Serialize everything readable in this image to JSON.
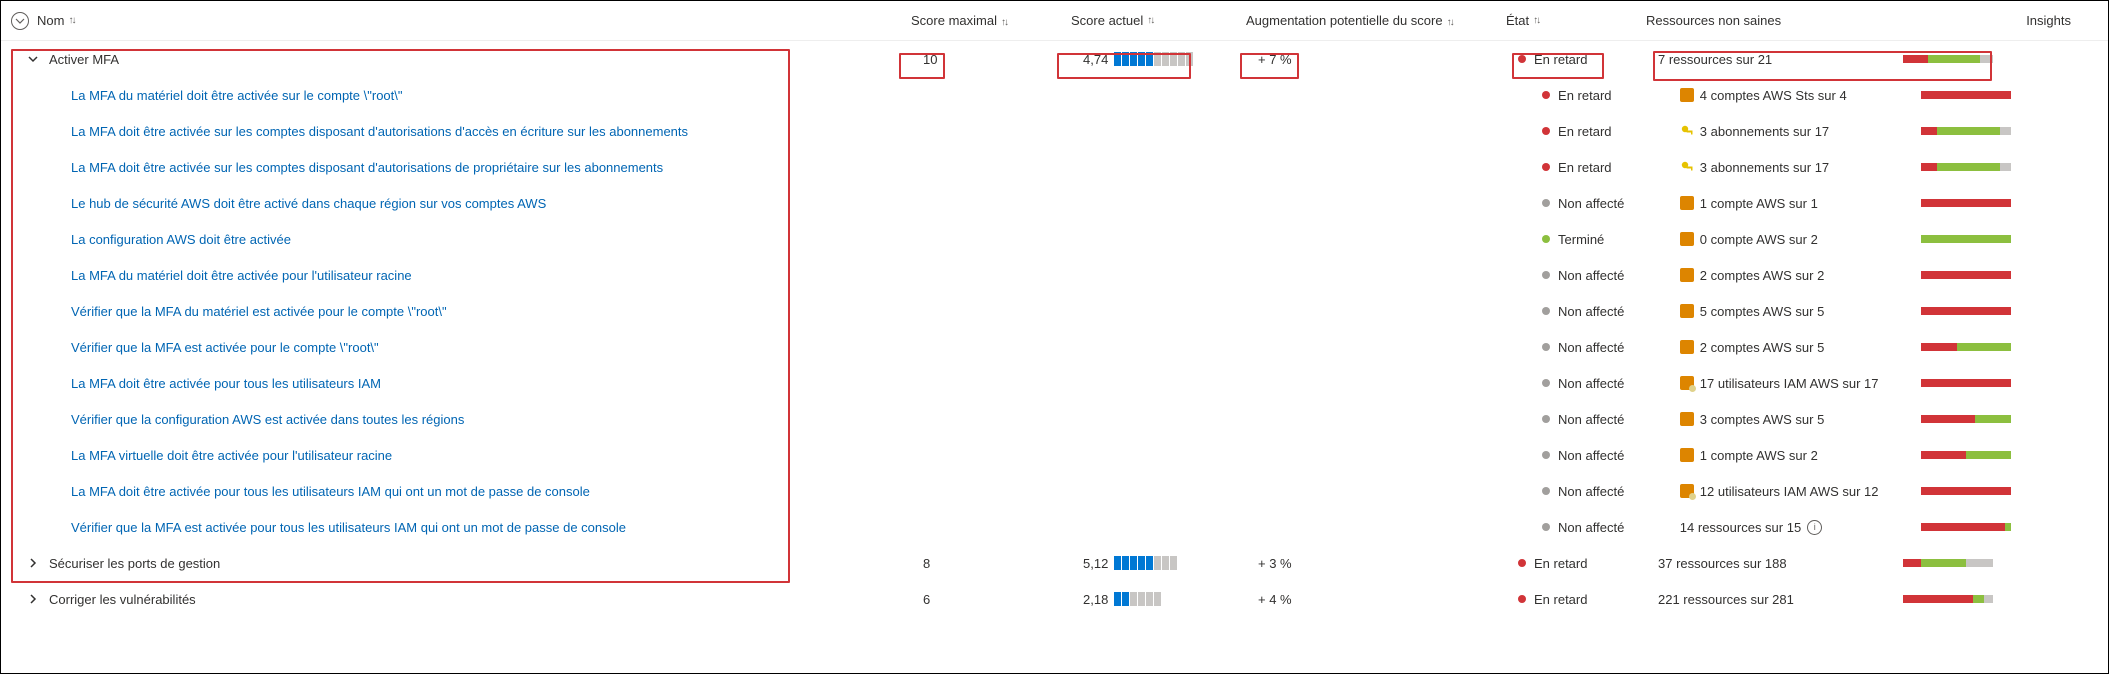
{
  "headers": {
    "name": "Nom",
    "max": "Score maximal",
    "cur": "Score actuel",
    "inc": "Augmentation potentielle du score",
    "state": "État",
    "res": "Ressources non saines",
    "insights": "Insights"
  },
  "groups": [
    {
      "name": "Activer MFA",
      "expanded": true,
      "max": "10",
      "cur": "4,74",
      "cur_blocks_on": 5,
      "cur_blocks_total": 10,
      "inc": "+ 7 %",
      "state_dot": "red",
      "state_text": "En retard",
      "res_text": "7 ressources sur 21",
      "res_icon": "",
      "bar": [
        [
          "r",
          28
        ],
        [
          "g",
          58
        ],
        [
          "gr",
          14
        ]
      ],
      "highlight": true,
      "items": [
        {
          "name": "La MFA du matériel doit être activée sur le compte \\\"root\\\"",
          "state_dot": "red",
          "state_text": "En retard",
          "res_icon": "aws",
          "res_text": "4 comptes AWS Sts sur 4",
          "bar": [
            [
              "r",
              100
            ]
          ]
        },
        {
          "name": "La MFA doit être activée sur les comptes disposant d'autorisations d'accès en écriture sur les abonnements",
          "state_dot": "red",
          "state_text": "En retard",
          "res_icon": "key",
          "res_text": "3 abonnements sur 17",
          "bar": [
            [
              "r",
              18
            ],
            [
              "g",
              70
            ],
            [
              "gr",
              12
            ]
          ]
        },
        {
          "name": "La MFA doit être activée sur les comptes disposant d'autorisations de propriétaire sur les abonnements",
          "state_dot": "red",
          "state_text": "En retard",
          "res_icon": "key",
          "res_text": "3 abonnements sur 17",
          "bar": [
            [
              "r",
              18
            ],
            [
              "g",
              70
            ],
            [
              "gr",
              12
            ]
          ]
        },
        {
          "name": "Le hub de sécurité AWS doit être activé dans chaque région sur vos comptes AWS",
          "state_dot": "grey",
          "state_text": "Non affecté",
          "res_icon": "aws",
          "res_text": "1 compte AWS sur 1",
          "bar": [
            [
              "r",
              100
            ]
          ]
        },
        {
          "name": "La configuration AWS doit être activée",
          "state_dot": "green",
          "state_text": "Terminé",
          "res_icon": "aws",
          "res_text": "0 compte AWS sur 2",
          "bar": [
            [
              "g",
              100
            ]
          ]
        },
        {
          "name": "La MFA du matériel doit être activée pour l'utilisateur racine",
          "state_dot": "grey",
          "state_text": "Non affecté",
          "res_icon": "aws",
          "res_text": "2 comptes AWS sur 2",
          "bar": [
            [
              "r",
              100
            ]
          ]
        },
        {
          "name": "Vérifier que la MFA du matériel est activée pour le compte \\\"root\\\"",
          "state_dot": "grey",
          "state_text": "Non affecté",
          "res_icon": "aws",
          "res_text": "5 comptes AWS sur 5",
          "bar": [
            [
              "r",
              100
            ]
          ]
        },
        {
          "name": "Vérifier que la MFA est activée pour le compte \\\"root\\\"",
          "state_dot": "grey",
          "state_text": "Non affecté",
          "res_icon": "aws",
          "res_text": "2 comptes AWS sur 5",
          "bar": [
            [
              "r",
              40
            ],
            [
              "g",
              60
            ]
          ]
        },
        {
          "name": "La MFA doit être activée pour tous les utilisateurs IAM",
          "state_dot": "grey",
          "state_text": "Non affecté",
          "res_icon": "users",
          "res_text": "17 utilisateurs IAM AWS sur 17",
          "bar": [
            [
              "r",
              100
            ]
          ]
        },
        {
          "name": "Vérifier que la configuration AWS est activée dans toutes les régions",
          "state_dot": "grey",
          "state_text": "Non affecté",
          "res_icon": "aws",
          "res_text": "3 comptes AWS sur 5",
          "bar": [
            [
              "r",
              60
            ],
            [
              "g",
              40
            ]
          ]
        },
        {
          "name": "La MFA virtuelle doit être activée pour l'utilisateur racine",
          "state_dot": "grey",
          "state_text": "Non affecté",
          "res_icon": "aws",
          "res_text": "1 compte AWS sur 2",
          "bar": [
            [
              "r",
              50
            ],
            [
              "g",
              50
            ]
          ]
        },
        {
          "name": "La MFA doit être activée pour tous les utilisateurs IAM qui ont un mot de passe de console",
          "state_dot": "grey",
          "state_text": "Non affecté",
          "res_icon": "users",
          "res_text": "12 utilisateurs IAM AWS sur 12",
          "bar": [
            [
              "r",
              100
            ]
          ]
        },
        {
          "name": "Vérifier que la MFA est activée pour tous les utilisateurs IAM qui ont un mot de passe de console",
          "state_dot": "grey",
          "state_text": "Non affecté",
          "res_icon": "",
          "res_text": "14 ressources sur 15",
          "res_info": true,
          "bar": [
            [
              "r",
              93
            ],
            [
              "g",
              7
            ]
          ]
        }
      ]
    },
    {
      "name": "Sécuriser les ports de gestion",
      "expanded": false,
      "max": "8",
      "cur": "5,12",
      "cur_blocks_on": 5,
      "cur_blocks_total": 8,
      "inc": "+ 3 %",
      "state_dot": "red",
      "state_text": "En retard",
      "res_text": "37 ressources sur 188",
      "res_icon": "",
      "bar": [
        [
          "r",
          20
        ],
        [
          "g",
          50
        ],
        [
          "gr",
          30
        ]
      ]
    },
    {
      "name": "Corriger les vulnérabilités",
      "expanded": false,
      "max": "6",
      "cur": "2,18",
      "cur_blocks_on": 2,
      "cur_blocks_total": 6,
      "inc": "+ 4 %",
      "state_dot": "red",
      "state_text": "En retard",
      "res_text": "221 ressources sur 281",
      "res_icon": "",
      "bar": [
        [
          "r",
          78
        ],
        [
          "g",
          12
        ],
        [
          "gr",
          10
        ]
      ]
    }
  ]
}
